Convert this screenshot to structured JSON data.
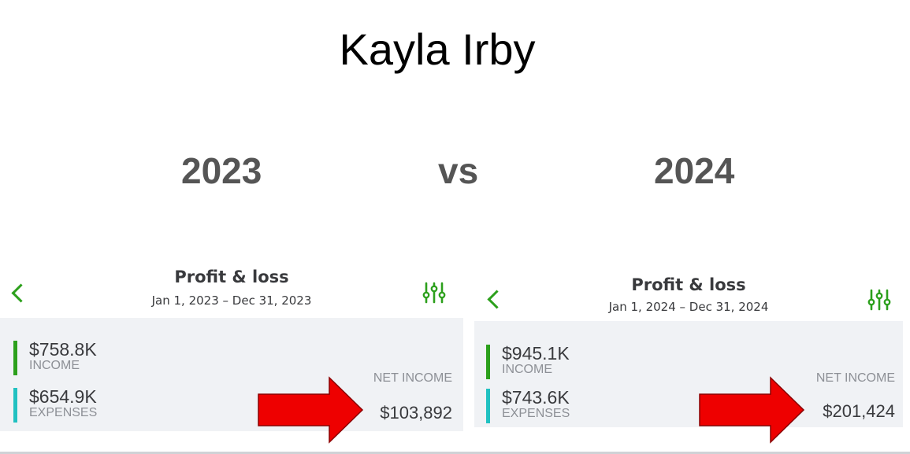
{
  "title": "Kayla Irby",
  "left_year": "2023",
  "vs": "vs",
  "right_year": "2024",
  "colors": {
    "accent": "#2ca01c",
    "income_bar": "#2ca01c",
    "expense_bar": "#21c1c1",
    "arrow": "#ee0000"
  },
  "panels": [
    {
      "header_title": "Profit & loss",
      "date_range": "Jan 1, 2023 – Dec 31, 2023",
      "income_value": "$758.8K",
      "income_label": "INCOME",
      "expenses_value": "$654.9K",
      "expenses_label": "EXPENSES",
      "net_label": "NET INCOME",
      "net_value": "$103,892"
    },
    {
      "header_title": "Profit & loss",
      "date_range": "Jan 1, 2024 – Dec 31, 2024",
      "income_value": "$945.1K",
      "income_label": "INCOME",
      "expenses_value": "$743.6K",
      "expenses_label": "EXPENSES",
      "net_label": "NET INCOME",
      "net_value": "$201,424"
    }
  ]
}
